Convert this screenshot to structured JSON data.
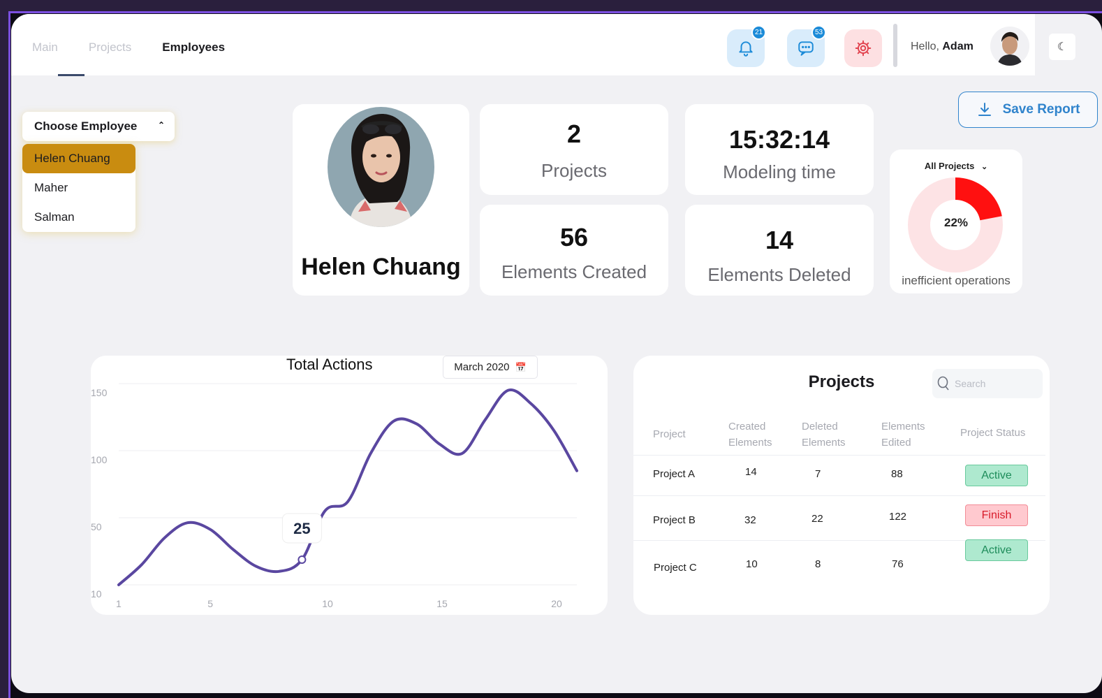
{
  "nav": {
    "tabs": [
      "Main",
      "Projects",
      "Employees"
    ],
    "active_index": 2
  },
  "header": {
    "notifications_count": "21",
    "messages_count": "53",
    "greeting": "Hello,",
    "user_name": "Adam"
  },
  "employee_selector": {
    "label": "Choose Employee",
    "options": [
      "Helen Chuang",
      "Maher",
      "Salman"
    ],
    "selected": "Helen Chuang"
  },
  "profile": {
    "name": "Helen Chuang"
  },
  "stats": {
    "projects": {
      "value": "2",
      "label": "Projects"
    },
    "modeling_time": {
      "value": "15:32:14",
      "label": "Modeling time"
    },
    "elements_created": {
      "value": "56",
      "label": "Elements Created"
    },
    "elements_deleted": {
      "value": "14",
      "label": "Elements Deleted"
    }
  },
  "inefficiency": {
    "filter": "All Projects",
    "percent": 22,
    "percent_label": "22%",
    "label": "inefficient operations"
  },
  "save_report": {
    "label": "Save Report"
  },
  "chart_data": {
    "type": "line",
    "title": "Total Actions",
    "date_filter": "March 2020",
    "x_ticks": [
      "1",
      "5",
      "10",
      "15",
      "20"
    ],
    "y_ticks": [
      "150",
      "100",
      "50",
      "10"
    ],
    "x": [
      1,
      2,
      3,
      4,
      5,
      6,
      7,
      8,
      9,
      10,
      11,
      12,
      13,
      14,
      15,
      16,
      17,
      18,
      19,
      20,
      21
    ],
    "values": [
      10,
      22,
      38,
      47,
      43,
      31,
      21,
      18,
      25,
      55,
      62,
      98,
      122,
      120,
      105,
      98,
      123,
      145,
      135,
      115,
      85
    ],
    "highlight": {
      "x": 9,
      "value": "25"
    },
    "color": "#5a47a0"
  },
  "projects_table": {
    "title": "Projects",
    "search_placeholder": "Search",
    "headers": [
      "Project",
      "Created Elements",
      "Deleted Elements",
      "Elements Edited",
      "Project Status"
    ],
    "rows": [
      {
        "project": "Project A",
        "created": "14",
        "deleted": "7",
        "edited": "88",
        "status": "Active"
      },
      {
        "project": "Project B",
        "created": "32",
        "deleted": "22",
        "edited": "122",
        "status": "Finish"
      },
      {
        "project": "Project C",
        "created": "10",
        "deleted": "8",
        "edited": "76",
        "status": "Active"
      }
    ],
    "status_colors": {
      "Active": "#1d8c5a",
      "Finish": "#d81b2a"
    }
  }
}
